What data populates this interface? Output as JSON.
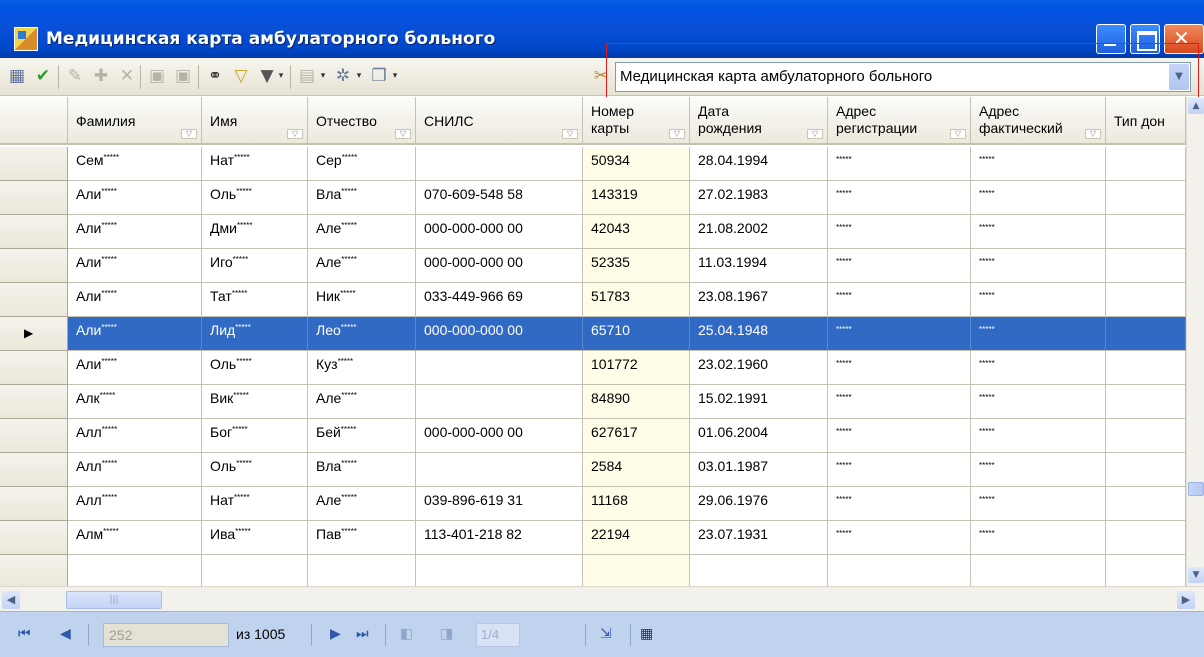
{
  "window": {
    "title": "Медицинская карта амбулаторного больного"
  },
  "toolbar": {
    "icons": [
      "grid-settings-icon",
      "apply-check-icon",
      "edit-icon",
      "add-icon",
      "delete-icon",
      "save-icon",
      "save-all-icon",
      "search-binoculars-icon",
      "clear-filter-icon",
      "filter-icon",
      "report-icon",
      "settings-gear-icon",
      "window-icon",
      "clear-icon"
    ],
    "form_select_value": "Медицинская карта амбулаторного больного"
  },
  "table": {
    "columns": [
      "Фамилия",
      "Имя",
      "Отчество",
      "СНИЛС",
      "Номер\nкарты",
      "Дата\nрождения",
      "Адрес\nрегистрации",
      "Адрес\nфактический",
      "Тип дон"
    ],
    "mask": "*****",
    "rows": [
      {
        "surname": "Сем",
        "name": "Нат",
        "patronymic": "Сер",
        "snils": "",
        "card": "50934",
        "birth": "28.04.1994"
      },
      {
        "surname": "Али",
        "name": "Оль",
        "patronymic": "Вла",
        "snils": "070-609-548 58",
        "card": "143319",
        "birth": "27.02.1983"
      },
      {
        "surname": "Али",
        "name": "Дми",
        "patronymic": "Але",
        "snils": "000-000-000 00",
        "card": "42043",
        "birth": "21.08.2002"
      },
      {
        "surname": "Али",
        "name": "Иго",
        "patronymic": "Але",
        "snils": "000-000-000 00",
        "card": "52335",
        "birth": "11.03.1994"
      },
      {
        "surname": "Али",
        "name": "Тат",
        "patronymic": "Ник",
        "snils": "033-449-966 69",
        "card": "51783",
        "birth": "23.08.1967"
      },
      {
        "surname": "Али",
        "name": "Лид",
        "patronymic": "Лео",
        "snils": "000-000-000 00",
        "card": "65710",
        "birth": "25.04.1948",
        "selected": true
      },
      {
        "surname": "Али",
        "name": "Оль",
        "patronymic": "Куз",
        "snils": "",
        "card": "101772",
        "birth": "23.02.1960"
      },
      {
        "surname": "Алк",
        "name": "Вик",
        "patronymic": "Але",
        "snils": "",
        "card": "84890",
        "birth": "15.02.1991"
      },
      {
        "surname": "Алл",
        "name": "Бог",
        "patronymic": "Бей",
        "snils": "000-000-000 00",
        "card": "627617",
        "birth": "01.06.2004"
      },
      {
        "surname": "Алл",
        "name": "Оль",
        "patronymic": "Вла",
        "snils": "",
        "card": "2584",
        "birth": "03.01.1987"
      },
      {
        "surname": "Алл",
        "name": "Нат",
        "patronymic": "Але",
        "snils": "039-896-619 31",
        "card": "11168",
        "birth": "29.06.1976"
      },
      {
        "surname": "Алм",
        "name": "Ива",
        "patronymic": "Пав",
        "snils": "113-401-218 82",
        "card": "22194",
        "birth": "23.07.1931"
      }
    ]
  },
  "navigator": {
    "position": "252",
    "count_label": "из 1005",
    "page": "1/4"
  },
  "colors": {
    "title_bar": "#0054e3",
    "selection": "#316ac5",
    "highlight_border": "#e21a1a"
  }
}
